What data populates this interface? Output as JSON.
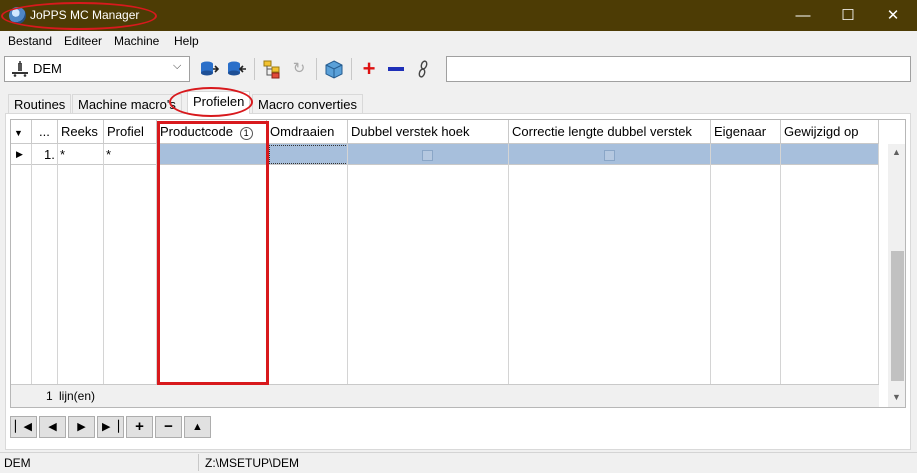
{
  "window": {
    "title": "JoPPS MC Manager",
    "controls": {
      "minimize": "—",
      "maximize": "☐",
      "close": "✕"
    }
  },
  "menu": [
    "Bestand",
    "Editeer",
    "Machine",
    "Help"
  ],
  "toolbar": {
    "machine_select_value": "DEM",
    "search_value": ""
  },
  "tabs": [
    "Routines",
    "Machine macro's",
    "Profielen",
    "Macro converties"
  ],
  "active_tab": "Profielen",
  "grid": {
    "columns": [
      "...",
      "Reeks",
      "Profiel",
      "Productcode",
      "Omdraaien",
      "Dubbel verstek hoek",
      "Correctie lengte dubbel verstek",
      "Eigenaar",
      "Gewijzigd op"
    ],
    "sort_badge": "1",
    "row": {
      "number": "1.",
      "reeks": "*",
      "profiel": "*",
      "omdraaien": false,
      "dubbel_verstek_hoek": false
    },
    "footer_count": "1",
    "footer_label": "lijn(en)"
  },
  "status": {
    "left": "DEM",
    "path": "Z:\\MSETUP\\DEM"
  },
  "colors": {
    "titlebar": "#4d3c05",
    "selection": "#a7bfdc",
    "highlight": "#d8191d"
  }
}
